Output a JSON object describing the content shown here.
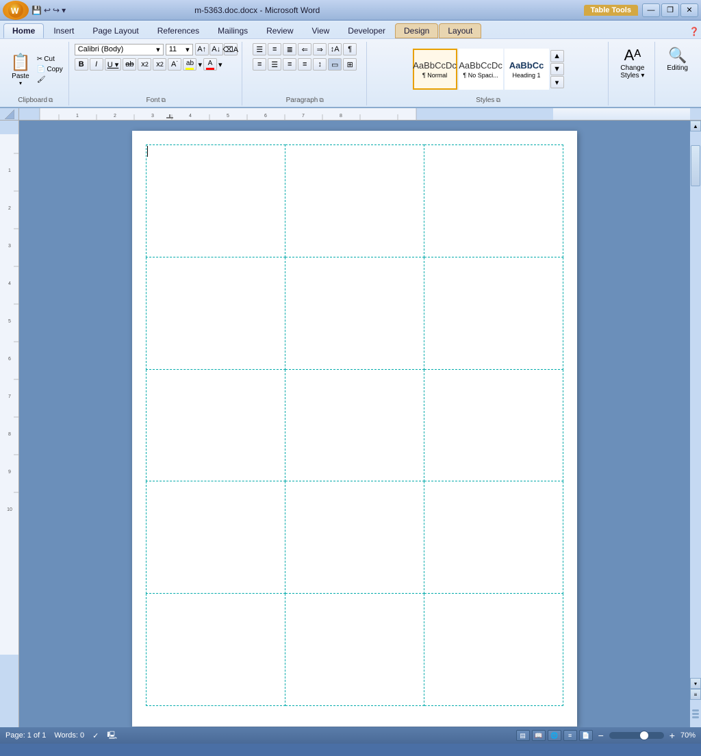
{
  "titlebar": {
    "title": "m-5363.doc.docx - Microsoft Word",
    "table_tools": "Table Tools",
    "minimize": "—",
    "restore": "❐",
    "close": "✕"
  },
  "quickaccess": {
    "save": "💾",
    "undo": "↩",
    "redo": "↪",
    "dropdown": "▾"
  },
  "ribbon": {
    "tabs": [
      "Home",
      "Insert",
      "Page Layout",
      "References",
      "Mailings",
      "Review",
      "View",
      "Developer",
      "Design",
      "Layout"
    ],
    "active_tab": "Home",
    "table_tools_tabs": [
      "Design",
      "Layout"
    ],
    "groups": {
      "clipboard": {
        "label": "Clipboard",
        "paste": "Paste"
      },
      "font": {
        "label": "Font",
        "family": "Calibri (Body)",
        "size": "11",
        "bold": "B",
        "italic": "I",
        "underline": "U",
        "strikethrough": "ab",
        "subscript": "x₂",
        "superscript": "x²",
        "textcolor": "A",
        "highlight": "ab"
      },
      "paragraph": {
        "label": "Paragraph"
      },
      "styles": {
        "label": "Styles",
        "items": [
          {
            "name": "Normal",
            "preview": "AaBbCcDc",
            "active": true
          },
          {
            "name": "No Spaci...",
            "preview": "AaBbCcDc",
            "active": false
          },
          {
            "name": "Heading 1",
            "preview": "AaBbCc",
            "active": false
          }
        ]
      },
      "editstyles": {
        "label": "Change\nStyles"
      },
      "editing": {
        "label": "Editing"
      }
    }
  },
  "document": {
    "table": {
      "rows": 5,
      "cols": 3
    },
    "cursor_visible": true
  },
  "statusbar": {
    "page": "Page: 1 of 1",
    "words": "Words: 0",
    "spell_check": "✓",
    "zoom": "70%",
    "zoom_out": "−",
    "zoom_in": "+"
  }
}
